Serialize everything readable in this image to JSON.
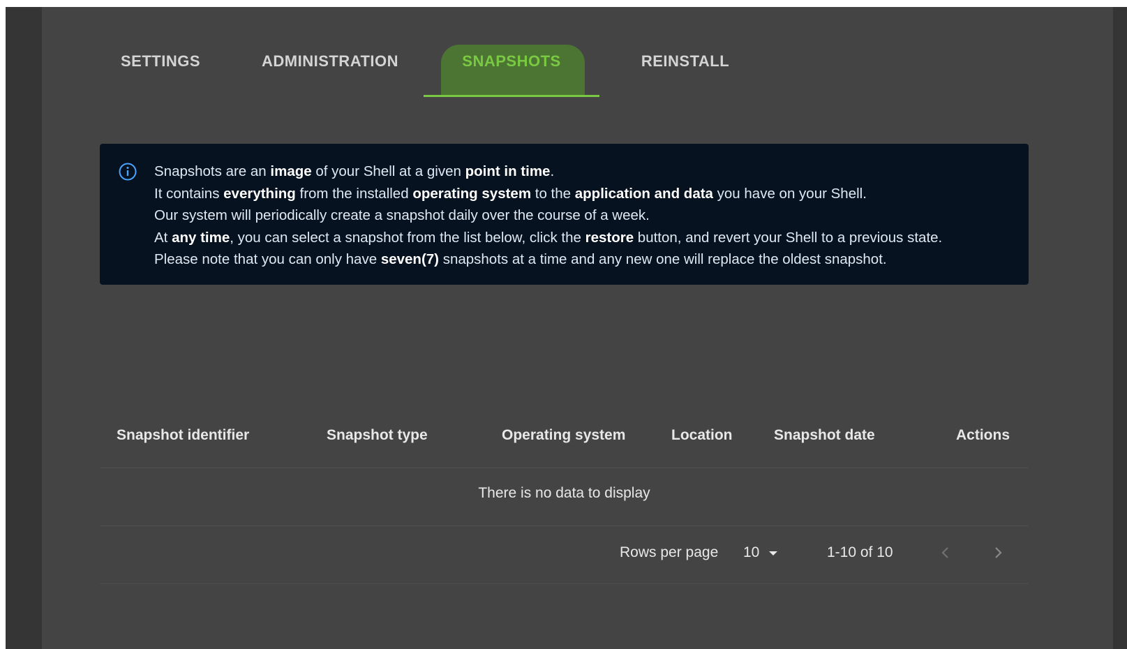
{
  "tabs": [
    {
      "label": "SETTINGS",
      "active": false
    },
    {
      "label": "ADMINISTRATION",
      "active": false
    },
    {
      "label": "SNAPSHOTS",
      "active": true
    },
    {
      "label": "REINSTALL",
      "active": false
    }
  ],
  "colors": {
    "accent": "#7ac943",
    "info_bg": "#06121f",
    "info_icon": "#4aa3ff"
  },
  "info": {
    "icon": "info-circle-icon",
    "lines": [
      [
        {
          "t": "Snapshots are an ",
          "b": false
        },
        {
          "t": "image",
          "b": true
        },
        {
          "t": " of your Shell at a given ",
          "b": false
        },
        {
          "t": "point in time",
          "b": true
        },
        {
          "t": ".",
          "b": false
        }
      ],
      [
        {
          "t": "It contains ",
          "b": false
        },
        {
          "t": "everything",
          "b": true
        },
        {
          "t": " from the installed ",
          "b": false
        },
        {
          "t": "operating system",
          "b": true
        },
        {
          "t": " to the ",
          "b": false
        },
        {
          "t": "application and data",
          "b": true
        },
        {
          "t": " you have on your Shell.",
          "b": false
        }
      ],
      [
        {
          "t": "Our system will periodically create a snapshot daily over the course of a week.",
          "b": false
        }
      ],
      [
        {
          "t": "At ",
          "b": false
        },
        {
          "t": "any time",
          "b": true
        },
        {
          "t": ", you can select a snapshot from the list below, click the ",
          "b": false
        },
        {
          "t": "restore",
          "b": true
        },
        {
          "t": " button, and revert your Shell to a previous state.",
          "b": false
        }
      ],
      [
        {
          "t": "Please note that you can only have ",
          "b": false
        },
        {
          "t": "seven(7)",
          "b": true
        },
        {
          "t": " snapshots at a time and any new one will replace the oldest snapshot.",
          "b": false
        }
      ]
    ]
  },
  "table": {
    "columns": [
      "Snapshot identifier",
      "Snapshot type",
      "Operating system",
      "Location",
      "Snapshot date",
      "Actions"
    ],
    "empty_message": "There is no data to display"
  },
  "pagination": {
    "rows_per_page_label": "Rows per page",
    "rows_per_page_value": "10",
    "range_text": "1-10 of 10",
    "prev_icon": "chevron-left-icon",
    "next_icon": "chevron-right-icon"
  }
}
